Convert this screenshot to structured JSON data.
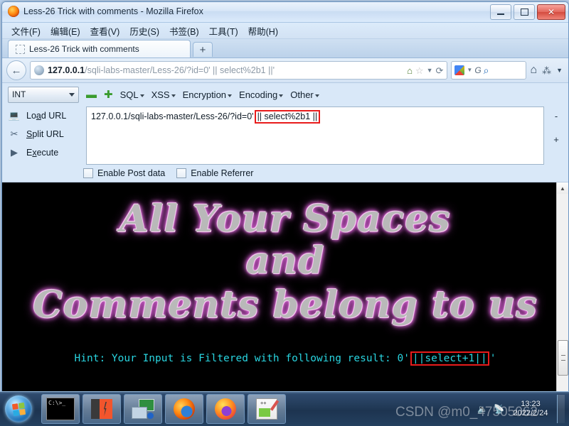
{
  "window": {
    "title": "Less-26 Trick with comments - Mozilla Firefox",
    "app_icon": "firefox-logo-icon",
    "controls": {
      "minimize": "minimize-button",
      "maximize": "maximize-button",
      "close": "close-button",
      "close_glyph": "✕"
    }
  },
  "menubar": {
    "items": [
      {
        "label": "文件(F)"
      },
      {
        "label": "编辑(E)"
      },
      {
        "label": "查看(V)"
      },
      {
        "label": "历史(S)"
      },
      {
        "label": "书签(B)"
      },
      {
        "label": "工具(T)"
      },
      {
        "label": "帮助(H)"
      }
    ]
  },
  "tabs": {
    "active": "Less-26 Trick with comments",
    "new_tab_label": "+"
  },
  "navbar": {
    "back_glyph": "←",
    "url_host": "127.0.0.1",
    "url_path": "/sqli-labs-master/Less-26/?id=0' || select%2b1 ||'",
    "home_page_glyph": "⌂",
    "bookmark_glyph": "☆",
    "dropdown_glyph": "▼",
    "reload_glyph": "⟳",
    "search_engine_glyph": "G",
    "search_magnifier_glyph": "⌕",
    "home_button_glyph": "⌂",
    "addon_glyph": "⁂",
    "overflow_glyph": "▼"
  },
  "hackbar": {
    "type_select": "INT",
    "remove_glyph": "▬",
    "add_glyph": "✚",
    "menus": [
      {
        "label": "SQL"
      },
      {
        "label": "XSS"
      },
      {
        "label": "Encryption"
      },
      {
        "label": "Encoding"
      },
      {
        "label": "Other"
      }
    ],
    "buttons": [
      {
        "label_pre": "Lo",
        "accel": "a",
        "label_post": "d URL",
        "icon": "load-url-icon"
      },
      {
        "label_pre": "",
        "accel": "S",
        "label_post": "plit URL",
        "icon": "split-url-icon"
      },
      {
        "label_pre": "E",
        "accel": "x",
        "label_post": "ecute",
        "icon": "execute-icon"
      }
    ],
    "textarea_value_plain": "127.0.0.1/sqli-labs-master/Less-26/?id=0'",
    "textarea_value_boxed": "|| select%2b1 ||",
    "side_minus": "-",
    "side_plus": "+",
    "checkboxes": [
      {
        "label": "Enable Post data",
        "checked": false
      },
      {
        "label": "Enable Referrer",
        "checked": false
      }
    ]
  },
  "page": {
    "heading_line1": "All Your Spaces",
    "heading_line2": "and",
    "heading_line3": "Comments belong to us",
    "hint_prefix": "Hint: Your Input is Filtered with following result: 0'",
    "hint_boxed": "||select+1||",
    "hint_suffix": "'",
    "hint_color": "#29d5e0",
    "background_color": "#000000",
    "highlight_box_color": "#e81b1b"
  },
  "scrollbars": {
    "v_up_glyph": "▲",
    "v_down_glyph": "▼",
    "h_left_glyph": "◀",
    "h_right_glyph": "▶"
  },
  "taskbar": {
    "start_label": "start-orb",
    "items": [
      {
        "name": "command-prompt",
        "label": "C:\\>_"
      },
      {
        "name": "burp-suite",
        "label": ""
      },
      {
        "name": "network-tool",
        "label": ""
      },
      {
        "name": "firefox-old",
        "label": ""
      },
      {
        "name": "firefox-new",
        "label": ""
      },
      {
        "name": "notepad-plus-plus",
        "label": "++"
      }
    ],
    "clock_time": "13:23",
    "clock_date": "2022/2/24",
    "watermark": "CSDN @m0_47505062"
  }
}
